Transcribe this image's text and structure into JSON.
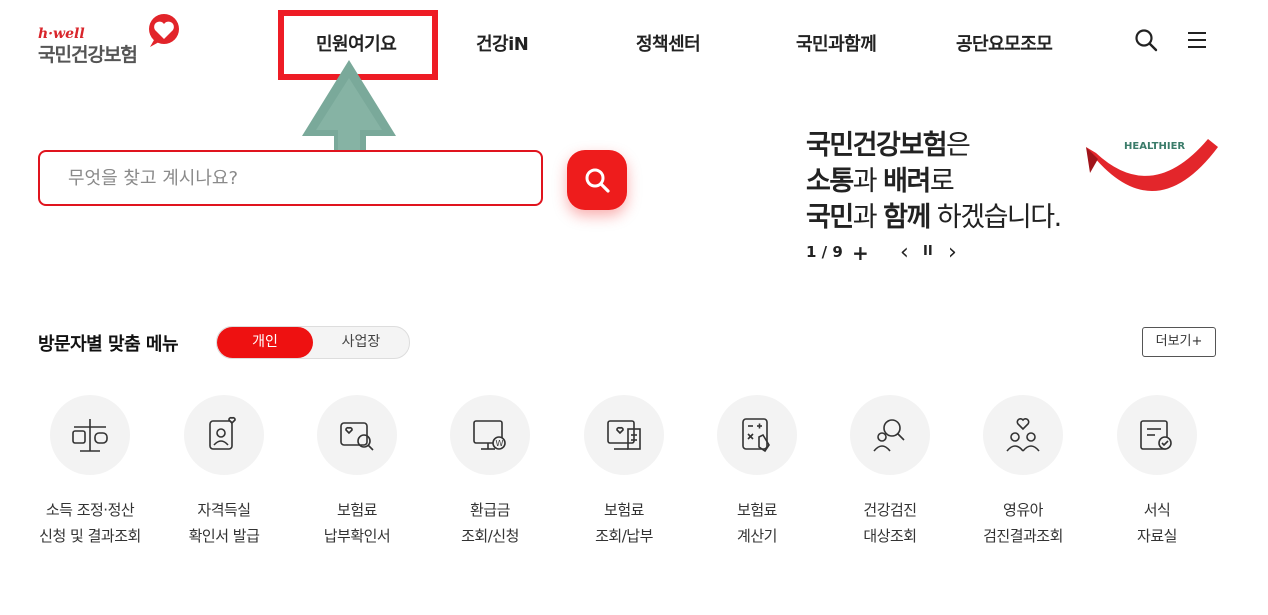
{
  "logo": {
    "tagline": "h·well",
    "name": "국민건강보험"
  },
  "nav": {
    "items": [
      "민원여기요",
      "건강iN",
      "정책센터",
      "국민과함께",
      "공단요모조모"
    ]
  },
  "search": {
    "placeholder": "무엇을 찾고 계시나요?",
    "value": ""
  },
  "banner": {
    "line1_bold": "국민건강보험",
    "line1_rest": "은",
    "line2_bold1": "소통",
    "line2_mid": "과 ",
    "line2_bold2": "배려",
    "line2_rest": "로",
    "line3_bold1": "국민",
    "line3_mid": "과 ",
    "line3_bold2": "함께",
    "line3_rest": " 하겠습니다.",
    "art_text": "HEALTHIER",
    "counter": "1 / 9",
    "plus": "+",
    "prev": "‹",
    "pause": "II",
    "next": "›"
  },
  "section": {
    "title": "방문자별 맞춤 메뉴",
    "toggle": [
      "개인",
      "사업장"
    ],
    "active_toggle": "개인",
    "more_label": "더보기+"
  },
  "menu": [
    {
      "line1": "소득 조정·정산",
      "line2": "신청 및 결과조회",
      "icon": "scale-icon"
    },
    {
      "line1": "자격득실",
      "line2": "확인서 발급",
      "icon": "id-heart-icon"
    },
    {
      "line1": "보험료",
      "line2": "납부확인서",
      "icon": "card-search-icon"
    },
    {
      "line1": "환급금",
      "line2": "조회/신청",
      "icon": "monitor-won-icon"
    },
    {
      "line1": "보험료",
      "line2": "조회/납부",
      "icon": "bill-icon"
    },
    {
      "line1": "보험료",
      "line2": "계산기",
      "icon": "calculator-icon"
    },
    {
      "line1": "건강검진",
      "line2": "대상조회",
      "icon": "person-search-icon"
    },
    {
      "line1": "영유아",
      "line2": "검진결과조회",
      "icon": "family-heart-icon"
    },
    {
      "line1": "서식",
      "line2": "자료실",
      "icon": "document-check-icon"
    }
  ],
  "colors": {
    "accent": "#ee1c25",
    "annotation_arrow": "#7aa99a"
  }
}
